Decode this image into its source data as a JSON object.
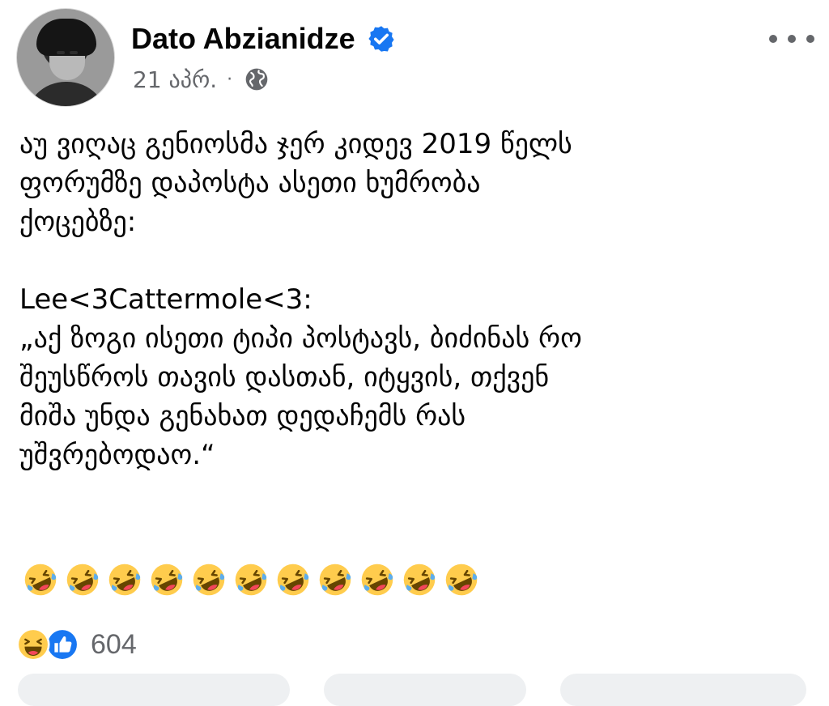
{
  "post": {
    "author_name": "Dato Abzianidze",
    "timestamp": "21 აპრ.",
    "separator": "·",
    "text_lines": [
      "აუ ვიღაც გენიოსმა ჯერ კიდევ 2019 წელს",
      "ფორუმზე დაპოსტა ასეთი ხუმრობა",
      "ქოცებზე:",
      "",
      "Lee<3Cattermole<3:",
      "„აქ ზოგი ისეთი ტიპი პოსტავს, ბიძინას რო",
      "შეუსწროს თავის დასთან, იტყვის, თქვენ",
      "მიშა უნდა გენახათ დედაჩემს რას",
      "უშვრებოდაო.“"
    ],
    "emoji_count": 11,
    "emoji_icon": "rolling-on-floor-laughing-icon"
  },
  "reactions": {
    "count": "604",
    "icons": [
      "haha-reaction-icon",
      "like-reaction-icon"
    ]
  },
  "colors": {
    "verified_blue": "#1877f2",
    "secondary_text": "#65676b",
    "emoji_yellow": "#ffcc4d"
  }
}
